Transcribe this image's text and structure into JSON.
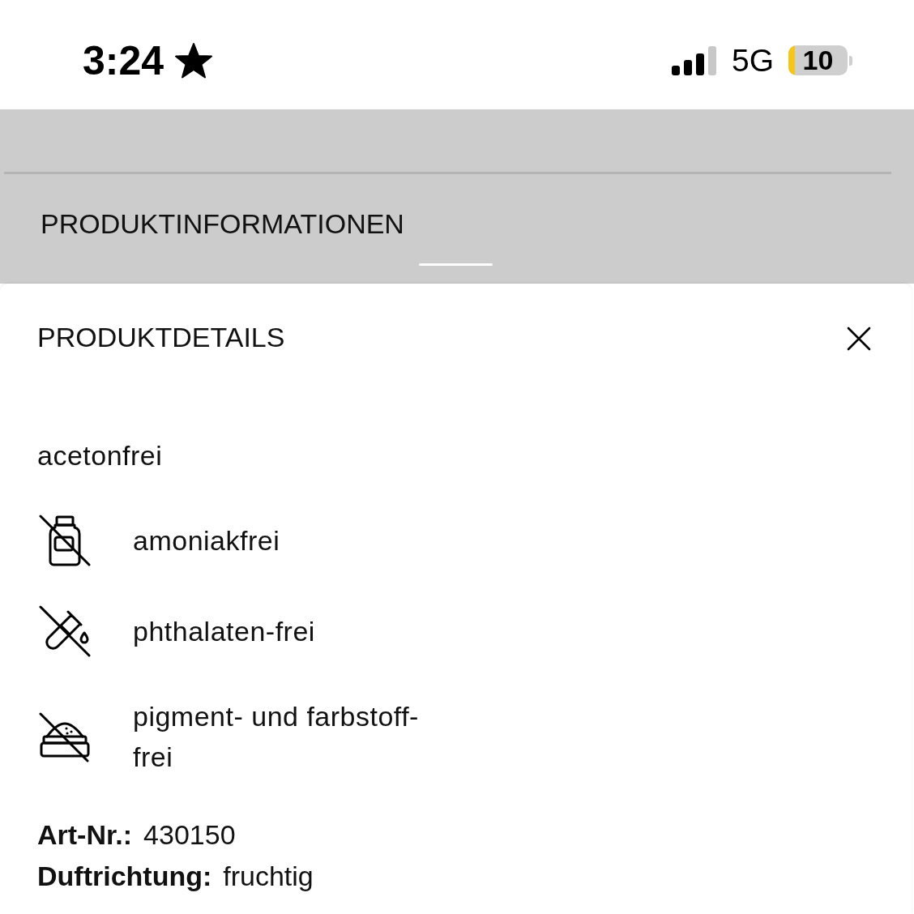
{
  "status_bar": {
    "time": "3:24",
    "network": "5G",
    "battery": "10",
    "low_power_mode": true
  },
  "header": {
    "title": "PRODUKTINFORMATIONEN"
  },
  "sheet": {
    "title": "PRODUKTDETAILS",
    "features": [
      {
        "kind": "plain",
        "label": "acetonfrei"
      },
      {
        "kind": "bottle",
        "label": "amoniakfrei"
      },
      {
        "kind": "test-tube",
        "label": "phthalaten-frei"
      },
      {
        "kind": "powder-jar",
        "label": "pigment- und farbstoff-frei"
      }
    ],
    "specs": [
      {
        "label": "Art-Nr.:",
        "value": "430150"
      },
      {
        "label": "Duftrichtung:",
        "value": "fruchtig"
      }
    ]
  }
}
